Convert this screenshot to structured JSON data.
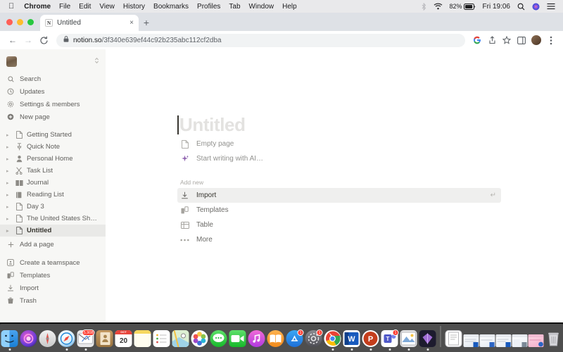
{
  "menubar": {
    "apple_icon": "apple-icon",
    "items": [
      {
        "label": "Chrome",
        "bold": true
      },
      {
        "label": "File",
        "bold": false
      },
      {
        "label": "Edit",
        "bold": false
      },
      {
        "label": "View",
        "bold": false
      },
      {
        "label": "History",
        "bold": false
      },
      {
        "label": "Bookmarks",
        "bold": false
      },
      {
        "label": "Profiles",
        "bold": false
      },
      {
        "label": "Tab",
        "bold": false
      },
      {
        "label": "Window",
        "bold": false
      },
      {
        "label": "Help",
        "bold": false
      }
    ],
    "status": {
      "bluetooth_icon": "bluetooth-icon",
      "wifi_icon": "wifi-icon",
      "battery_percent": "82%",
      "battery_icon": "battery-icon",
      "clock": "Fri 19:06",
      "search_icon": "spotlight-search-icon",
      "siri_icon": "siri-icon",
      "control_center_icon": "control-center-icon"
    }
  },
  "browser": {
    "tab": {
      "favicon": "notion-favicon",
      "title": "Untitled",
      "close_label": "×"
    },
    "new_tab_label": "+",
    "nav": {
      "back_icon": "back-arrow-icon",
      "forward_icon": "forward-arrow-icon",
      "reload_icon": "reload-icon"
    },
    "omnibox": {
      "lock_icon": "lock-icon",
      "host": "notion.so",
      "path": "/3f340e639ef44c92b235abc112cf2dba"
    },
    "actions": {
      "google_icon": "google-icon",
      "share_icon": "share-icon",
      "bookmark_icon": "bookmark-star-icon",
      "side_panel_icon": "side-panel-icon",
      "profile_icon": "profile-avatar-icon",
      "menu_icon": "kebab-menu-icon"
    }
  },
  "sidebar": {
    "workspace": {
      "avatar": "workspace-avatar",
      "chevron": "⌃⌄"
    },
    "actions": [
      {
        "label": "Search",
        "icon": "search-icon"
      },
      {
        "label": "Updates",
        "icon": "clock-icon"
      },
      {
        "label": "Settings & members",
        "icon": "gear-icon"
      },
      {
        "label": "New page",
        "icon": "plus-circle-icon"
      }
    ],
    "pages": [
      {
        "label": "Getting Started",
        "icon": "page-icon",
        "selected": false
      },
      {
        "label": "Quick Note",
        "icon": "pushpin-icon",
        "selected": false
      },
      {
        "label": "Personal Home",
        "icon": "person-icon",
        "selected": false
      },
      {
        "label": "Task List",
        "icon": "scissors-icon",
        "selected": false
      },
      {
        "label": "Journal",
        "icon": "open-book-icon",
        "selected": false
      },
      {
        "label": "Reading List",
        "icon": "book-icon",
        "selected": false
      },
      {
        "label": "Day 3",
        "icon": "page-icon",
        "selected": false
      },
      {
        "label": "The United States Shoul…",
        "icon": "page-icon",
        "selected": false
      },
      {
        "label": "Untitled",
        "icon": "page-icon",
        "selected": true
      }
    ],
    "add_page": {
      "label": "Add a page",
      "icon": "plus-icon"
    },
    "footer": [
      {
        "label": "Create a teamspace",
        "icon": "teamspace-icon"
      },
      {
        "label": "Templates",
        "icon": "templates-icon"
      },
      {
        "label": "Import",
        "icon": "import-icon"
      },
      {
        "label": "Trash",
        "icon": "trash-icon"
      }
    ]
  },
  "document": {
    "title_placeholder": "Untitled",
    "hints": [
      {
        "label": "Empty page",
        "icon": "page-icon"
      },
      {
        "label": "Start writing with AI…",
        "icon": "ai-sparkle-icon"
      }
    ],
    "add_new_label": "Add new",
    "menu": [
      {
        "label": "Import",
        "icon": "import-icon",
        "active": true,
        "kbd": "↵"
      },
      {
        "label": "Templates",
        "icon": "templates-icon",
        "active": false,
        "kbd": ""
      },
      {
        "label": "Table",
        "icon": "table-icon",
        "active": false,
        "kbd": ""
      },
      {
        "label": "More",
        "icon": "ellipsis-icon",
        "active": false,
        "kbd": ""
      }
    ]
  },
  "dock": {
    "apps": [
      {
        "name": "Finder",
        "running": true,
        "badge": ""
      },
      {
        "name": "Siri",
        "running": false,
        "badge": ""
      },
      {
        "name": "Launchpad",
        "running": false,
        "badge": ""
      },
      {
        "name": "Safari",
        "running": true,
        "badge": ""
      },
      {
        "name": "Mail",
        "running": true,
        "badge": "5,908"
      },
      {
        "name": "Contacts",
        "running": false,
        "badge": ""
      },
      {
        "name": "Calendar",
        "running": false,
        "badge": "20"
      },
      {
        "name": "Notes",
        "running": false,
        "badge": ""
      },
      {
        "name": "Reminders",
        "running": false,
        "badge": ""
      },
      {
        "name": "Maps",
        "running": false,
        "badge": ""
      },
      {
        "name": "Photos",
        "running": false,
        "badge": ""
      },
      {
        "name": "Messages",
        "running": false,
        "badge": ""
      },
      {
        "name": "FaceTime",
        "running": false,
        "badge": ""
      },
      {
        "name": "iTunes",
        "running": false,
        "badge": ""
      },
      {
        "name": "iBooks",
        "running": false,
        "badge": ""
      },
      {
        "name": "App Store",
        "running": false,
        "badge": "1"
      },
      {
        "name": "System Preferences",
        "running": false,
        "badge": "1"
      },
      {
        "name": "Google Chrome",
        "running": true,
        "badge": ""
      },
      {
        "name": "Microsoft Word",
        "running": true,
        "badge": ""
      },
      {
        "name": "Microsoft PowerPoint",
        "running": true,
        "badge": ""
      },
      {
        "name": "Microsoft Teams",
        "running": true,
        "badge": "1"
      },
      {
        "name": "Preview",
        "running": true,
        "badge": ""
      },
      {
        "name": "Sketch",
        "running": true,
        "badge": ""
      }
    ],
    "minimized": [
      "document",
      "window-1",
      "window-2",
      "window-3",
      "window-4",
      "window-5"
    ],
    "trash": "Trash"
  },
  "colors": {
    "sidebar_bg": "#f7f7f5",
    "selected_row": "#e9e9e7",
    "menu_active": "#efefee",
    "ai_purple": "#9065b0",
    "tabstrip": "#dee1e6",
    "text_dark": "#37352f",
    "text_muted": "#91918e"
  }
}
